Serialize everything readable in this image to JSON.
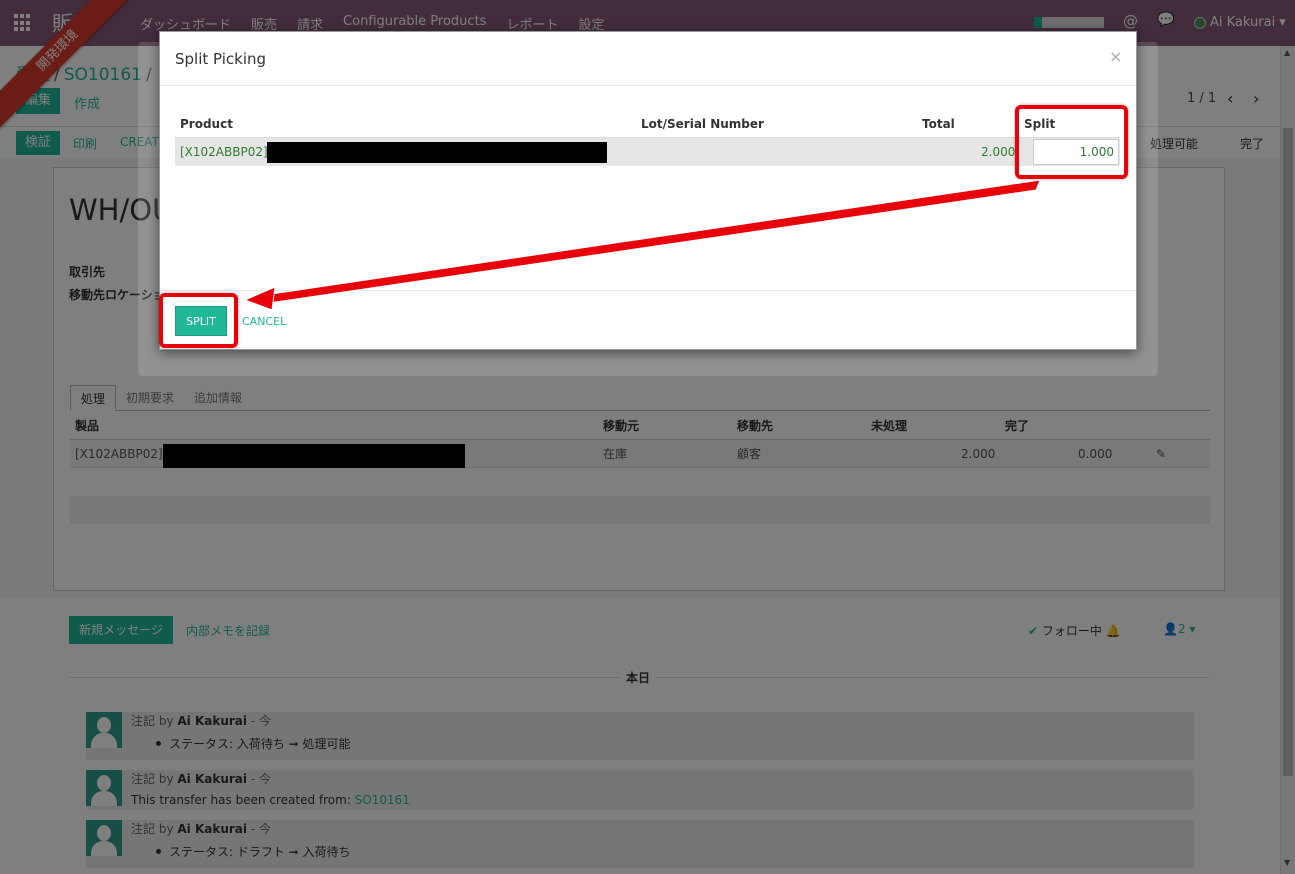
{
  "navbar": {
    "brand": "販売",
    "menu": [
      "ダッシュボード",
      "販売",
      "請求",
      "Configurable Products",
      "レポート",
      "設定"
    ],
    "user": "Ai Kakurai"
  },
  "ribbon": "開発環境",
  "control": {
    "breadcrumb": [
      "受注",
      "SO10161",
      ""
    ],
    "edit_label": "編集",
    "create_label": "作成",
    "pager": "1 / 1",
    "validate_label": "検証",
    "print_label": "印刷",
    "create_backorder_label": "CREAT",
    "stages": [
      "処理可能",
      "完了"
    ]
  },
  "form": {
    "title": "WH/OU",
    "partner_label": "取引先",
    "dest_label": "移動先ロケーション",
    "tabs": [
      "処理",
      "初期要求",
      "追加情報"
    ],
    "ops_headers": [
      "製品",
      "移動元",
      "移動先",
      "未処理",
      "完了"
    ],
    "ops_rows": [
      {
        "product": "[X102ABBP02]",
        "source": "在庫",
        "dest": "顧客",
        "todo": "2.000",
        "done": "0.000"
      }
    ]
  },
  "chatter": {
    "new_message": "新規メッセージ",
    "log_note": "内部メモを記録",
    "following": "フォロー中",
    "followers_count": "2",
    "today": "本日",
    "messages": [
      {
        "kind": "注記",
        "by": "by",
        "author": "Ai Kakurai",
        "when": "- 今",
        "body": "ステータス: 入荷待ち ➞ 処理可能",
        "bullet": true
      },
      {
        "kind": "注記",
        "by": "by",
        "author": "Ai Kakurai",
        "when": "- 今",
        "body": "This transfer has been created from:",
        "link": "SO10161",
        "bullet": false
      },
      {
        "kind": "注記",
        "by": "by",
        "author": "Ai Kakurai",
        "when": "- 今",
        "body": "ステータス: ドラフト ➞ 入荷待ち",
        "bullet": true
      }
    ]
  },
  "modal": {
    "title": "Split Picking",
    "close": "×",
    "headers": {
      "product": "Product",
      "lot": "Lot/Serial Number",
      "total": "Total",
      "split": "Split"
    },
    "row": {
      "product": "[X102ABBP02]",
      "total": "2.000",
      "split": "1.000"
    },
    "split_button": "SPLIT",
    "cancel_button": "CANCEL"
  },
  "colors": {
    "brand": "#875a7b",
    "accent": "#21b799",
    "annotation": "#e8000a"
  },
  "icons": {
    "apps": "apps-grid-icon",
    "mention": "at-icon",
    "chat": "chat-icon",
    "follow_check": "check-icon",
    "bell": "bell-icon",
    "users": "user-icon",
    "edit": "pencil-icon"
  }
}
